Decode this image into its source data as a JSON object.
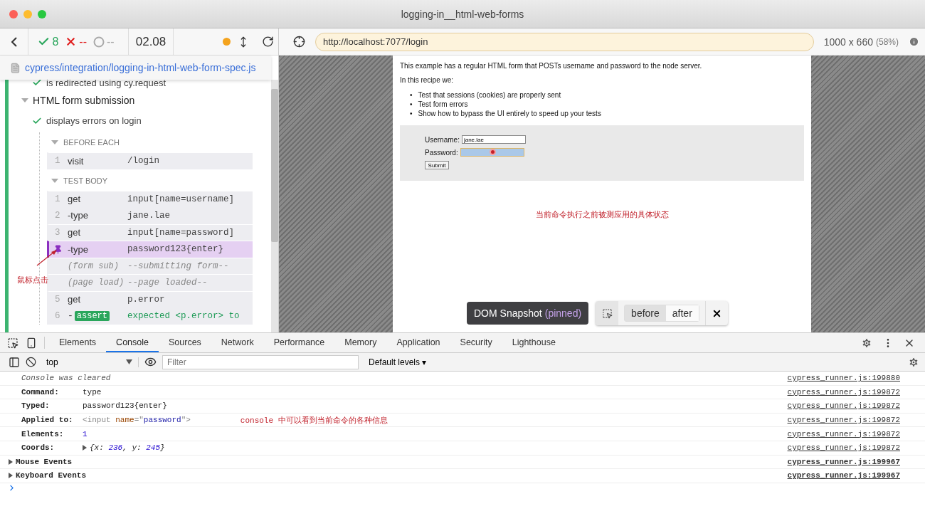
{
  "window": {
    "title": "logging-in__html-web-forms"
  },
  "reporter": {
    "stats": {
      "passed": "8",
      "failed": "--",
      "pending": "--"
    },
    "duration": "02.08",
    "spec_path": "cypress/integration/logging-in-html-web-form-spec.js",
    "tests": [
      {
        "kind": "test",
        "title": "is redirected using cy.request",
        "passed": true
      },
      {
        "kind": "suite",
        "title": "HTML form submission",
        "expanded": true
      },
      {
        "kind": "test",
        "title": "displays errors on login",
        "passed": true
      }
    ],
    "hooks": [
      {
        "title": "BEFORE EACH",
        "expanded": true,
        "commands": [
          {
            "kind": "command",
            "number": "1",
            "name": "visit",
            "message": "/login",
            "pinned": false,
            "first": true
          }
        ]
      },
      {
        "title": "TEST BODY",
        "expanded": true,
        "commands": [
          {
            "kind": "command",
            "number": "1",
            "name": "get",
            "message": "input[name=username]",
            "pinned": false,
            "first": true
          },
          {
            "kind": "child",
            "number": "2",
            "name": "-type",
            "message": "jane.lae",
            "pinned": false,
            "first": false
          },
          {
            "kind": "command",
            "number": "3",
            "name": "get",
            "message": "input[name=password]",
            "pinned": false,
            "first": true
          },
          {
            "kind": "child",
            "name": "-type",
            "message": "password123{enter}",
            "pinned": true,
            "first": true
          },
          {
            "kind": "event",
            "name": "(form sub)",
            "message": "--submitting form--",
            "pinned": false,
            "first": true
          },
          {
            "kind": "event",
            "name": "(page load)",
            "message": "--page loaded--",
            "pinned": false,
            "first": true
          },
          {
            "kind": "command",
            "number": "5",
            "name": "get",
            "message": "p.error",
            "pinned": false,
            "first": true
          },
          {
            "kind": "assert",
            "number": "6",
            "name": "-",
            "badge": "assert",
            "message": "expected <p.error> to",
            "pinned": false,
            "first": false
          }
        ]
      }
    ],
    "annotation": "鼠标点击"
  },
  "aut": {
    "url": "http://localhost:7077/login",
    "viewport": "1000 x 660",
    "scale": "(58%)",
    "page": {
      "intro": "This example has a regular HTML form that POSTs username and password to the node server.",
      "recipe": "In this recipe we:",
      "bullets": [
        {
          "marker": "•",
          "text": "Test that sessions (cookies) are properly sent"
        },
        {
          "marker": "•",
          "text": "Test form errors"
        },
        {
          "marker": "•",
          "text": "Show how to bypass the UI entirely to speed up your tests"
        }
      ],
      "form": {
        "username_label": "Username:",
        "username_value": "jane.lae",
        "password_label": "Password:",
        "password_highlighted": true,
        "submit": "Submit"
      }
    },
    "annotation": "当前命令执行之前被测应用的具体状态",
    "snapshot": {
      "label": "DOM Snapshot",
      "status": "(pinned)",
      "tabs": [
        {
          "label": "before",
          "selected": true
        },
        {
          "label": "after",
          "selected": false
        }
      ]
    }
  },
  "devtools": {
    "tabs": [
      {
        "label": "Elements",
        "selected": false
      },
      {
        "label": "Console",
        "selected": true
      },
      {
        "label": "Sources",
        "selected": false
      },
      {
        "label": "Network",
        "selected": false
      },
      {
        "label": "Performance",
        "selected": false
      },
      {
        "label": "Memory",
        "selected": false
      },
      {
        "label": "Application",
        "selected": false
      },
      {
        "label": "Security",
        "selected": false
      },
      {
        "label": "Lighthouse",
        "selected": false
      }
    ],
    "context": "top",
    "filter_placeholder": "Filter",
    "levels": "Default levels ▾",
    "messages": [
      {
        "kind": "info",
        "text": "Console was cleared",
        "source": "cypress_runner.js:199880"
      },
      {
        "kind": "prop",
        "label": "Command:",
        "tokens": [
          {
            "kind": "plain",
            "text": "type"
          }
        ],
        "source": "cypress_runner.js:199872"
      },
      {
        "kind": "prop",
        "label": "Typed:",
        "tokens": [
          {
            "kind": "plain",
            "text": "password123{enter}"
          }
        ],
        "source": "cypress_runner.js:199872"
      },
      {
        "kind": "prop",
        "label": "Applied to:",
        "tokens": [
          {
            "kind": "tag",
            "text": "<input "
          },
          {
            "kind": "attr",
            "text": "name"
          },
          {
            "kind": "tag",
            "text": "=\""
          },
          {
            "kind": "value",
            "text": "password"
          },
          {
            "kind": "tag",
            "text": "\">"
          }
        ],
        "note": "console 中可以看到当前命令的各种信息",
        "source": "cypress_runner.js:199872"
      },
      {
        "kind": "prop",
        "label": "Elements:",
        "tokens": [
          {
            "kind": "number",
            "text": "1"
          }
        ],
        "source": "cypress_runner.js:199872"
      },
      {
        "kind": "object",
        "label": "Coords:",
        "tokens": [
          {
            "kind": "plain",
            "text": "{x: "
          },
          {
            "kind": "number",
            "text": "236"
          },
          {
            "kind": "plain",
            "text": ", y: "
          },
          {
            "kind": "number",
            "text": "245"
          },
          {
            "kind": "plain",
            "text": "}"
          }
        ],
        "source": "cypress_runner.js:199872"
      },
      {
        "kind": "group",
        "label": "Mouse Events",
        "source": "cypress_runner.js:199967"
      },
      {
        "kind": "group",
        "label": "Keyboard Events",
        "source": "cypress_runner.js:199967"
      }
    ]
  }
}
